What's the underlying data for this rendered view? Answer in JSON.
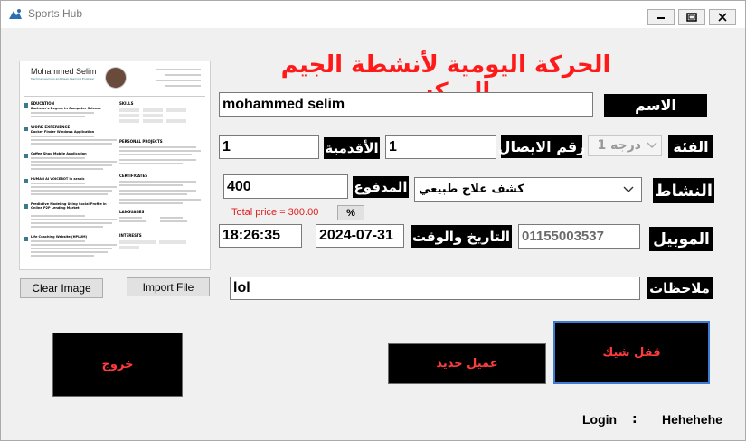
{
  "window": {
    "title": "Sports Hub"
  },
  "header": {
    "title": "الحركة اليومية لأنشطة الجيم الميكس"
  },
  "resume": {
    "name": "Mohammed Selim",
    "subtitle": "Machine Learning and Deep Learning Engineer",
    "sections": [
      "EDUCATION",
      "WORK EXPERIENCE",
      "SKILLS",
      "PERSONAL PROJECTS",
      "CERTIFICATES",
      "LANGUAGES",
      "INTERESTS"
    ],
    "entries": [
      "Bachelor's Degree in Computer Science",
      "Docker Finder Windows Application",
      "Coffee Shop Mobile Application",
      "HUMAN AI VOICEBOT in arabic",
      "Predictive Modeling Using Social Profile in Online P2P Lending Market",
      "Life Coaching Website (HPLUM)"
    ]
  },
  "buttons": {
    "clear_image": "Clear Image",
    "import_file": "Import File",
    "exit": "خروج",
    "new_client": "عميل جديد",
    "check_lock": "قفل شيك",
    "percent": "%"
  },
  "fields": {
    "name": {
      "label": "الاسم",
      "value": "mohammed selim"
    },
    "category": {
      "label": "الفئة",
      "value": "درجه 1"
    },
    "receipt": {
      "label": "رقم الايصال",
      "value": "1"
    },
    "seniority": {
      "label": "الأقدمية",
      "value": "1"
    },
    "activity": {
      "label": "النشاط",
      "value": "كشف علاج طبيعي"
    },
    "paid": {
      "label": "المدفوع",
      "value": "400"
    },
    "total_price": "Total price = 300.00",
    "mobile": {
      "label": "الموبيل",
      "value": "01155003537"
    },
    "datetime": {
      "label": "التاريخ والوقت",
      "date": "2024-07-31",
      "time": "18:26:35"
    },
    "notes": {
      "label": "ملاحظات",
      "value": "lol"
    }
  },
  "login": {
    "label": "Login",
    "sep": ":",
    "user": "Hehehehe"
  },
  "colors": {
    "title_red": "#ff1a1a",
    "total_red": "#e02020",
    "label_bg": "#000000",
    "button_text": "#ff3b3b"
  }
}
